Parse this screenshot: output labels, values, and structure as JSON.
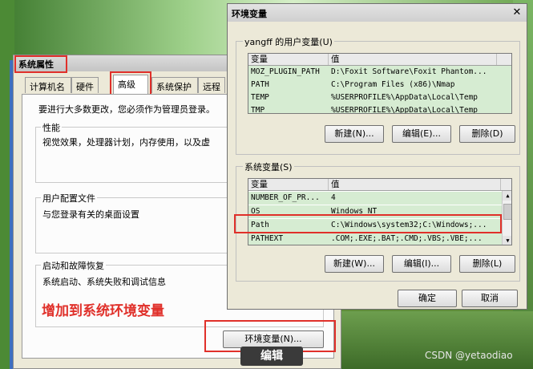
{
  "system_properties": {
    "title": "系统属性",
    "tabs": [
      "计算机名",
      "硬件",
      "高级",
      "系统保护",
      "远程"
    ],
    "notice": "要进行大多数更改，您必须作为管理员登录。",
    "performance": {
      "title": "性能",
      "text": "视觉效果，处理器计划，内存使用，以及虚"
    },
    "user_profile": {
      "title": "用户配置文件",
      "text": "与您登录有关的桌面设置"
    },
    "startup_recovery": {
      "title": "启动和故障恢复",
      "text": "系统启动、系统失败和调试信息"
    },
    "env_button": "环境变量(N)..."
  },
  "annotations": {
    "add_note": "增加到系统环境变量",
    "edit_caption": "编辑",
    "watermark": "CSDN @yetaodiao"
  },
  "env_dialog": {
    "title": "环境变量",
    "close": "✕",
    "user_vars": {
      "title": "yangff 的用户变量(U)",
      "columns": [
        "变量",
        "值"
      ],
      "rows": [
        [
          "MOZ_PLUGIN_PATH",
          "D:\\Foxit Software\\Foxit Phantom..."
        ],
        [
          "PATH",
          "C:\\Program Files (x86)\\Nmap"
        ],
        [
          "TEMP",
          "%USERPROFILE%\\AppData\\Local\\Temp"
        ],
        [
          "TMP",
          "%USERPROFILE%\\AppData\\Local\\Temp"
        ]
      ],
      "buttons": [
        "新建(N)...",
        "编辑(E)...",
        "删除(D)"
      ]
    },
    "system_vars": {
      "title": "系统变量(S)",
      "columns": [
        "变量",
        "值"
      ],
      "rows": [
        [
          "NUMBER_OF_PR...",
          "4"
        ],
        [
          "OS",
          "Windows_NT"
        ],
        [
          "Path",
          "C:\\Windows\\system32;C:\\Windows;..."
        ],
        [
          "PATHEXT",
          ".COM;.EXE;.BAT;.CMD;.VBS;.VBE;..."
        ]
      ],
      "buttons": [
        "新建(W)...",
        "编辑(I)...",
        "删除(L)"
      ]
    },
    "ok": "确定",
    "cancel": "取消"
  }
}
